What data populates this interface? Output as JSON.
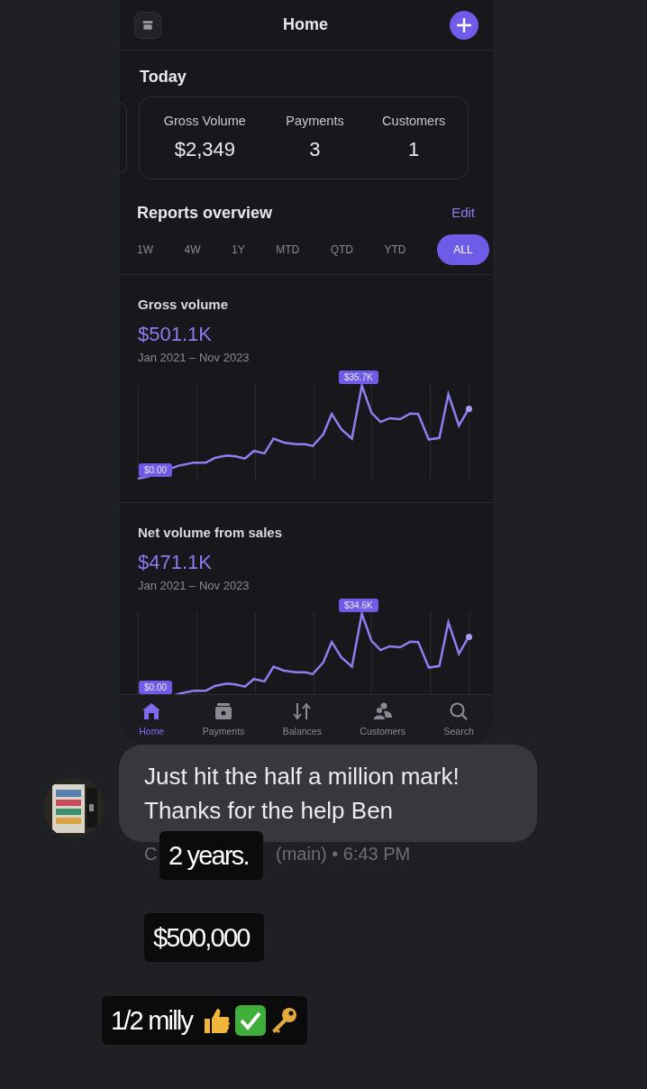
{
  "app": {
    "title": "Home",
    "today": {
      "title": "Today",
      "stats": [
        {
          "label": "Gross Volume",
          "value": "$2,349"
        },
        {
          "label": "Payments",
          "value": "3"
        },
        {
          "label": "Customers",
          "value": "1"
        }
      ]
    },
    "reports": {
      "title": "Reports overview",
      "edit": "Edit",
      "ranges": [
        {
          "label": "1W",
          "selected": false
        },
        {
          "label": "4W",
          "selected": false
        },
        {
          "label": "1Y",
          "selected": false
        },
        {
          "label": "MTD",
          "selected": false
        },
        {
          "label": "QTD",
          "selected": false
        },
        {
          "label": "YTD",
          "selected": false
        },
        {
          "label": "ALL",
          "selected": true
        }
      ],
      "cards": [
        {
          "title": "Gross volume",
          "total": "$501.1K",
          "period": "Jan 2021 – Nov 2023",
          "max_label": "$35.7K",
          "min_label": "$0.00"
        },
        {
          "title": "Net volume from sales",
          "total": "$471.1K",
          "period": "Jan 2021 – Nov 2023",
          "max_label": "$34.6K",
          "min_label": "$0.00"
        }
      ]
    },
    "nav": [
      {
        "label": "Home",
        "selected": true
      },
      {
        "label": "Payments",
        "selected": false
      },
      {
        "label": "Balances",
        "selected": false
      },
      {
        "label": "Customers",
        "selected": false
      },
      {
        "label": "Search",
        "selected": false
      }
    ]
  },
  "message": {
    "text": "Just hit the half a million mark!\nThanks for the help Ben",
    "sender": "C",
    "meta": "(main) • 6:43 PM"
  },
  "captions": [
    {
      "text": "2 years.",
      "kind": "plain"
    },
    {
      "text": "$500,000",
      "kind": "plain"
    },
    {
      "text": "1/2 milly",
      "kind": "with-emoji"
    }
  ]
}
